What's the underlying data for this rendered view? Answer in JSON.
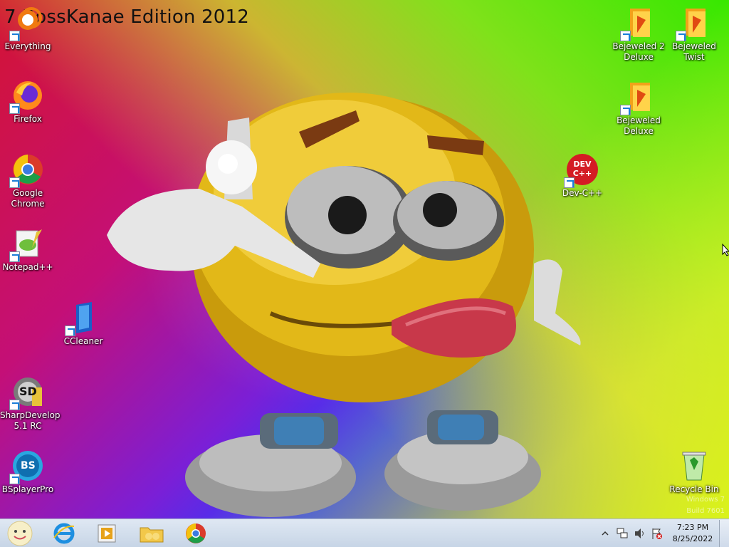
{
  "desktop": {
    "edition_title": "7 BossKanae Edition 2012",
    "watermark": [
      "Windows 7",
      "Build 7601"
    ],
    "icons": [
      {
        "id": "everything",
        "label": "Everything"
      },
      {
        "id": "firefox",
        "label": "Firefox"
      },
      {
        "id": "chrome",
        "label": "Google Chrome"
      },
      {
        "id": "notepadpp",
        "label": "Notepad++"
      },
      {
        "id": "ccleaner",
        "label": "CCleaner"
      },
      {
        "id": "sharpdevelop",
        "label": "SharpDevelop 5.1 RC"
      },
      {
        "id": "bsplayer",
        "label": "BSplayerPro"
      },
      {
        "id": "bejeweled2",
        "label": "Bejeweled 2 Deluxe"
      },
      {
        "id": "bejeweledtwist",
        "label": "Bejeweled Twist"
      },
      {
        "id": "bejeweled",
        "label": "Bejeweled Deluxe"
      },
      {
        "id": "devcpp",
        "label": "Dev-C++"
      },
      {
        "id": "recyclebin",
        "label": "Recycle Bin"
      }
    ],
    "devcpp_badge": "DEV C++",
    "sharpdevelop_badge": "SD",
    "bsplayer_badge": "BS"
  },
  "taskbar": {
    "pinned": [
      {
        "id": "internet-explorer",
        "icon": "internet-explorer-icon"
      },
      {
        "id": "media-player",
        "icon": "media-player-icon"
      },
      {
        "id": "file-explorer",
        "icon": "folder-icon"
      },
      {
        "id": "chrome",
        "icon": "chrome-icon"
      }
    ],
    "clock": {
      "time": "7:23 PM",
      "date": "8/25/2022"
    }
  },
  "colors": {
    "taskbar": "#d3deeb",
    "accent_orange": "#f07a10"
  }
}
